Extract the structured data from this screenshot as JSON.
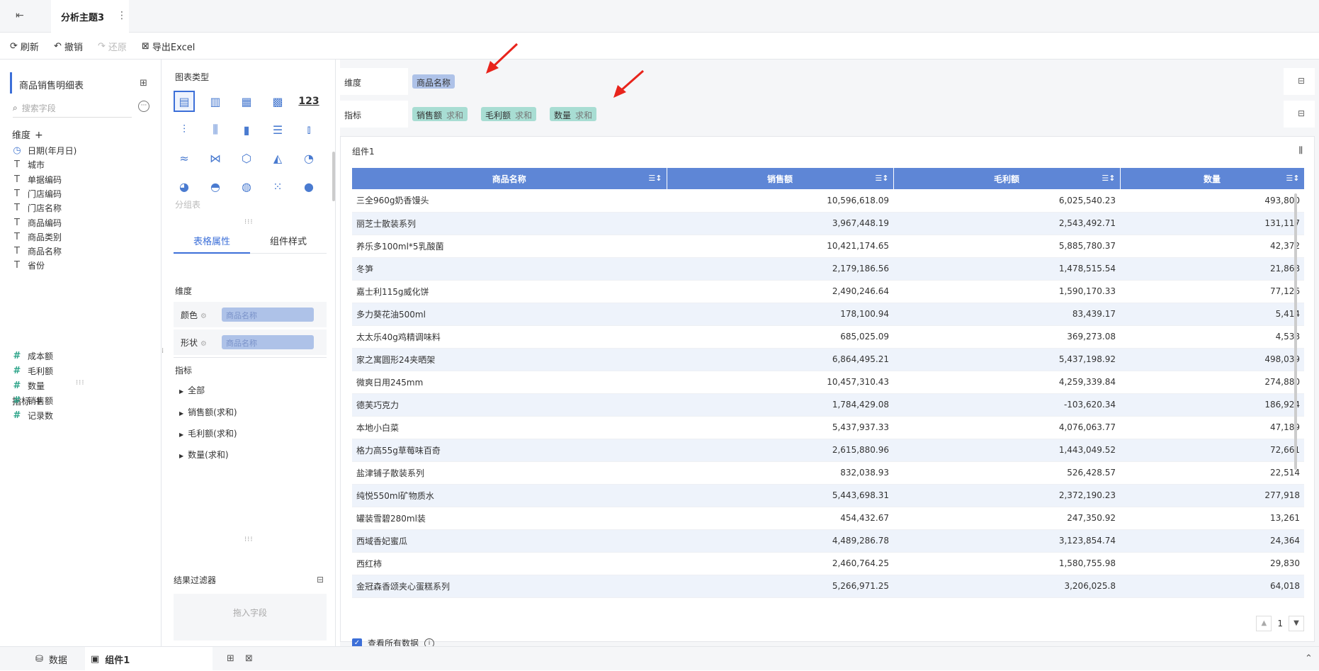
{
  "topbar": {
    "tab_title": "分析主题3",
    "more": "⋮",
    "back_icon": "exit-icon"
  },
  "toolbar": {
    "refresh": "刷新",
    "undo": "撤销",
    "redo": "还原",
    "export": "导出Excel"
  },
  "left": {
    "dataset": "商品销售明细表",
    "search_placeholder": "搜索字段",
    "dimensions_title": "维度",
    "dimensions": [
      {
        "type": "date",
        "label": "日期(年月日)"
      },
      {
        "type": "text",
        "label": "城市"
      },
      {
        "type": "text",
        "label": "单据编码"
      },
      {
        "type": "text",
        "label": "门店编码"
      },
      {
        "type": "text",
        "label": "门店名称"
      },
      {
        "type": "text",
        "label": "商品编码"
      },
      {
        "type": "text",
        "label": "商品类别"
      },
      {
        "type": "text",
        "label": "商品名称"
      },
      {
        "type": "text",
        "label": "省份"
      }
    ],
    "measures_title": "指标",
    "measures": [
      {
        "label": "成本额"
      },
      {
        "label": "毛利额"
      },
      {
        "label": "数量"
      },
      {
        "label": "销售额"
      },
      {
        "label": "记录数"
      }
    ]
  },
  "mid": {
    "chart_type_title": "图表类型",
    "group_table": "分组表",
    "tab_table_attr": "表格属性",
    "tab_widget_style": "组件样式",
    "dim_label": "维度",
    "color_label": "颜色",
    "color_value": "商品名称",
    "shape_label": "形状",
    "shape_value": "商品名称",
    "measure_label": "指标",
    "tree": [
      "全部",
      "销售额(求和)",
      "毛利额(求和)",
      "数量(求和)"
    ],
    "filter_title": "结果过滤器",
    "filter_drop": "拖入字段",
    "number_icon_text": "123"
  },
  "main": {
    "dim_shelf_label": "维度",
    "dim_chip": "商品名称",
    "mea_shelf_label": "指标",
    "mea_chips": [
      {
        "name": "销售额",
        "agg": "求和"
      },
      {
        "name": "毛利额",
        "agg": "求和"
      },
      {
        "name": "数量",
        "agg": "求和"
      }
    ],
    "widget_title": "组件1",
    "columns": [
      "商品名称",
      "销售额",
      "毛利额",
      "数量"
    ],
    "rows": [
      [
        "三全960g奶香馒头",
        "10,596,618.09",
        "6,025,540.23",
        "493,800"
      ],
      [
        "丽芝士散装系列",
        "3,967,448.19",
        "2,543,492.71",
        "131,117"
      ],
      [
        "养乐多100ml*5乳酸菌",
        "10,421,174.65",
        "5,885,780.37",
        "42,372"
      ],
      [
        "冬笋",
        "2,179,186.56",
        "1,478,515.54",
        "21,868"
      ],
      [
        "嘉士利115g威化饼",
        "2,490,246.64",
        "1,590,170.33",
        "77,126"
      ],
      [
        "多力葵花油500ml",
        "178,100.94",
        "83,439.17",
        "5,414"
      ],
      [
        "太太乐40g鸡精调味料",
        "685,025.09",
        "369,273.08",
        "4,538"
      ],
      [
        "家之寓圆形24夹晒架",
        "6,864,495.21",
        "5,437,198.92",
        "498,039"
      ],
      [
        "微爽日用245mm",
        "10,457,310.43",
        "4,259,339.84",
        "274,880"
      ],
      [
        "德芙巧克力",
        "1,784,429.08",
        "-103,620.34",
        "186,924"
      ],
      [
        "本地小白菜",
        "5,437,937.33",
        "4,076,063.77",
        "47,189"
      ],
      [
        "格力高55g草莓味百奇",
        "2,615,880.96",
        "1,443,049.52",
        "72,661"
      ],
      [
        "盐津铺子散装系列",
        "832,038.93",
        "526,428.57",
        "22,514"
      ],
      [
        "纯悦550ml矿物质水",
        "5,443,698.31",
        "2,372,190.23",
        "277,918"
      ],
      [
        "罐装雪碧280ml装",
        "454,432.67",
        "247,350.92",
        "13,261"
      ],
      [
        "西域香妃蜜瓜",
        "4,489,286.78",
        "3,123,854.74",
        "24,364"
      ],
      [
        "西红柿",
        "2,460,764.25",
        "1,580,755.98",
        "29,830"
      ],
      [
        "金冠森香颂夹心蛋糕系列",
        "5,266,971.25",
        "3,206,025.8",
        "64,018"
      ]
    ],
    "page": "1",
    "view_all": "查看所有数据"
  },
  "bottombar": {
    "data_tab": "数据",
    "widget_tab": "组件1"
  },
  "colors": {
    "accent": "#3c6fd8",
    "header": "#5e86d6",
    "dim_chip": "#aec2e8",
    "mea_chip": "#a8ddd3",
    "arrow": "#e8241c"
  }
}
